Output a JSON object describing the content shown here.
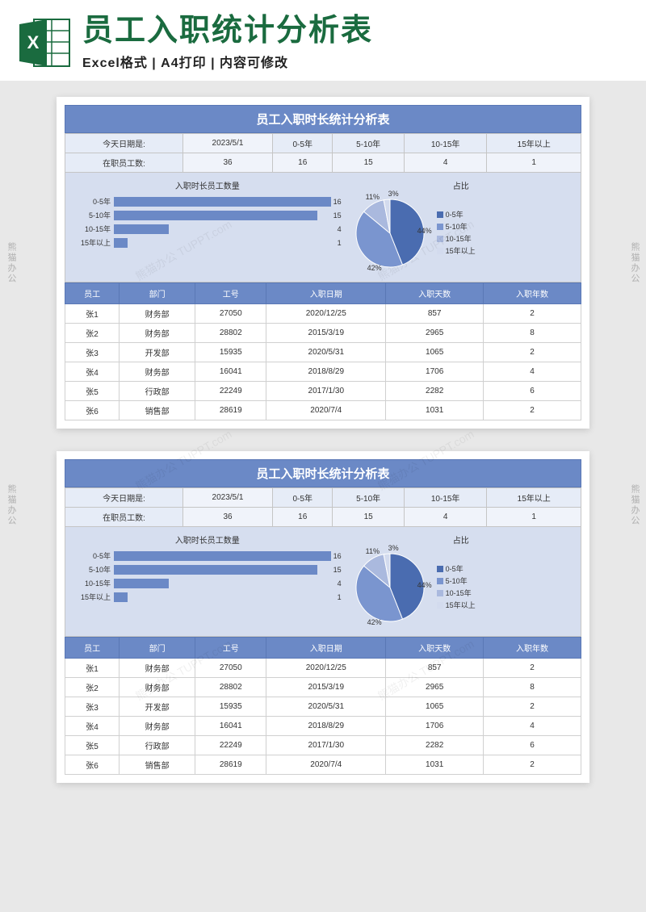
{
  "header": {
    "title": "员工入职统计分析表",
    "subtitle": "Excel格式 | A4打印 | 内容可修改"
  },
  "sheet_title": "员工入职时长统计分析表",
  "summary": {
    "row1_label": "今天日期是:",
    "row2_label": "在职员工数:",
    "today": "2023/5/1",
    "total": "36",
    "buckets": [
      "0-5年",
      "5-10年",
      "10-15年",
      "15年以上"
    ],
    "counts": [
      "16",
      "15",
      "4",
      "1"
    ]
  },
  "chart_data": [
    {
      "type": "bar",
      "title": "入职时长员工数量",
      "categories": [
        "0-5年",
        "5-10年",
        "10-15年",
        "15年以上"
      ],
      "values": [
        16,
        15,
        4,
        1
      ],
      "xlim": [
        0,
        16
      ]
    },
    {
      "type": "pie",
      "title": "占比",
      "series": [
        {
          "name": "0-5年",
          "value": 44,
          "color": "#4a6cb0"
        },
        {
          "name": "5-10年",
          "value": 42,
          "color": "#7a95cf"
        },
        {
          "name": "10-15年",
          "value": 11,
          "color": "#aab9de"
        },
        {
          "name": "15年以上",
          "value": 3,
          "color": "#d3dbee"
        }
      ]
    }
  ],
  "table": {
    "headers": [
      "员工",
      "部门",
      "工号",
      "入职日期",
      "入职天数",
      "入职年数"
    ],
    "rows": [
      [
        "张1",
        "财务部",
        "27050",
        "2020/12/25",
        "857",
        "2"
      ],
      [
        "张2",
        "财务部",
        "28802",
        "2015/3/19",
        "2965",
        "8"
      ],
      [
        "张3",
        "开发部",
        "15935",
        "2020/5/31",
        "1065",
        "2"
      ],
      [
        "张4",
        "财务部",
        "16041",
        "2018/8/29",
        "1706",
        "4"
      ],
      [
        "张5",
        "行政部",
        "22249",
        "2017/1/30",
        "2282",
        "6"
      ],
      [
        "张6",
        "销售部",
        "28619",
        "2020/7/4",
        "1031",
        "2"
      ]
    ]
  },
  "watermark_text": "熊猫办公 TUPPT.com",
  "side_text": "熊猫办公"
}
